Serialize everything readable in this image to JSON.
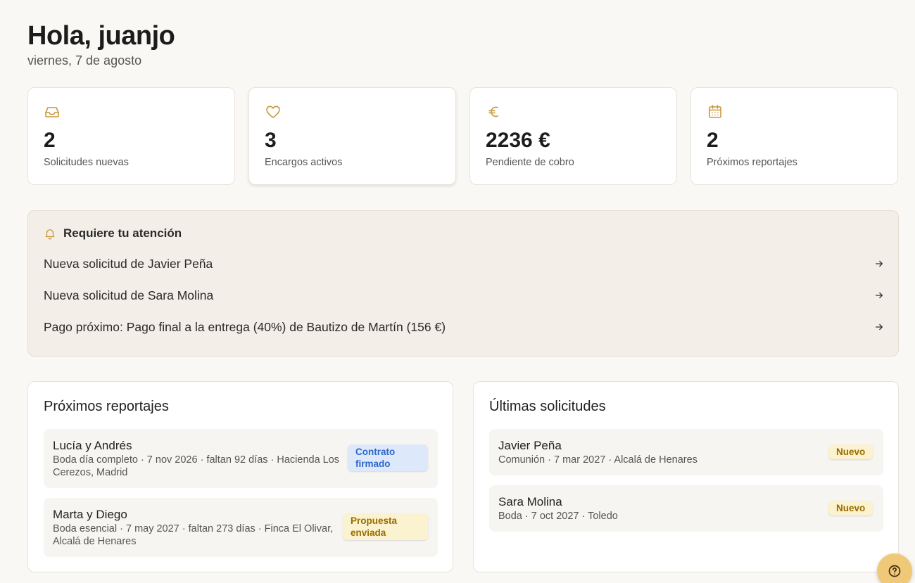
{
  "header": {
    "greeting": "Hola, juanjo",
    "date": "viernes, 7 de agosto"
  },
  "stats": [
    {
      "icon": "inbox-icon",
      "value": "2",
      "label": "Solicitudes nuevas"
    },
    {
      "icon": "heart-icon",
      "value": "3",
      "label": "Encargos activos"
    },
    {
      "icon": "euro-icon",
      "value": "2236 €",
      "label": "Pendiente de cobro"
    },
    {
      "icon": "calendar-icon",
      "value": "2",
      "label": "Próximos reportajes"
    }
  ],
  "attention": {
    "icon": "bell-icon",
    "title": "Requiere tu atención",
    "items": [
      {
        "text": "Nueva solicitud de Javier Peña"
      },
      {
        "text": "Nueva solicitud de Sara Molina"
      },
      {
        "text": "Pago próximo: Pago final a la entrega (40%) de Bautizo de Martín (156 €)"
      }
    ]
  },
  "upcoming": {
    "title": "Próximos reportajes",
    "items": [
      {
        "name": "Lucía y Andrés",
        "meta_line1": "Boda día completo · 7 nov 2026 · faltan 92 días · Hacienda Los",
        "meta_line2": "Cerezos, Madrid",
        "badge_line1": "Contrato",
        "badge_line2": "firmado"
      },
      {
        "name": "Marta y Diego",
        "meta_line1": "Boda esencial · 7 may 2027 · faltan 273 días · Finca El Olivar,",
        "meta_line2": "Alcalá de Henares",
        "badge_line1": "Propuesta",
        "badge_line2": "enviada"
      }
    ]
  },
  "requests": {
    "title": "Últimas solicitudes",
    "items": [
      {
        "name": "Javier Peña",
        "meta": "Comunión · 7 mar 2027 · Alcalá de Henares",
        "badge": "Nuevo"
      },
      {
        "name": "Sara Molina",
        "meta": "Boda · 7 oct 2027 · Toledo",
        "badge": "Nuevo"
      }
    ]
  },
  "colors": {
    "accent": "#f0c978",
    "background": "#faf8f5",
    "attention_bg": "#f3efe8"
  }
}
